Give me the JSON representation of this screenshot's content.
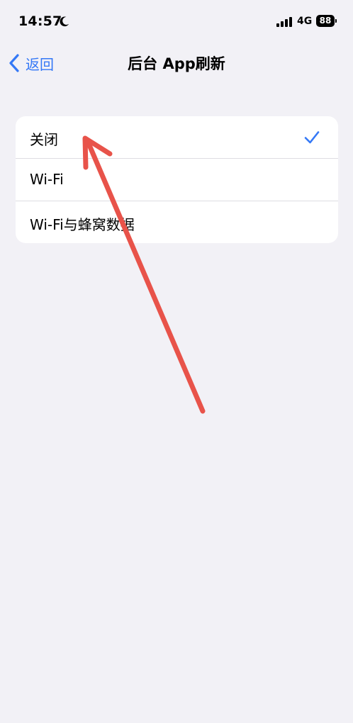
{
  "status_bar": {
    "time": "14:57",
    "moon_icon": "moon-icon",
    "signal_icon": "cellular-signal-icon",
    "network": "4G",
    "battery": "88"
  },
  "nav": {
    "back_label": "返回",
    "back_icon": "chevron-left-icon",
    "title": "后台 App刷新"
  },
  "options": [
    {
      "label": "关闭",
      "selected": true
    },
    {
      "label": "Wi-Fi",
      "selected": false
    },
    {
      "label": "Wi-Fi与蜂窝数据",
      "selected": false
    }
  ],
  "colors": {
    "accent": "#3478f6",
    "background": "#f2f1f6",
    "annotation": "#e8534a"
  }
}
